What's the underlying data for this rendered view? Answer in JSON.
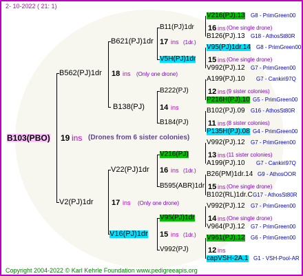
{
  "header": {
    "date": "2- 10-2022 ( 21:  1)"
  },
  "footer": {
    "copyright": "Copyright 2004-2022 © Karl Kehrle Foundation    www.pedigreeapis.org"
  },
  "root": {
    "name": "B103(PBO)",
    "gen": "19",
    "ins": "ins",
    "note": "(Drones from 6 sister colonies)"
  },
  "g1": {
    "top": {
      "name": "B562(PJ)1dr",
      "gen": "18",
      "ins": "ins",
      "note": "(Only one drone)"
    },
    "bottom": {
      "name": "V2(PJ)1dr",
      "gen": "17",
      "ins": "ins",
      "note": "(Only one drone)"
    }
  },
  "g2": {
    "n1": {
      "name": "B621(PJ)1dr",
      "gen": "17",
      "ins": "ins",
      "note": "(1dr.)"
    },
    "n2": {
      "name": "B138(PJ)",
      "gen": "14",
      "ins": "ins"
    },
    "n3": {
      "name": "V22(PJ)1dr",
      "gen": "16",
      "ins": "ins",
      "note": "(1dr.)"
    },
    "n4": {
      "name": "V16(PJ)1dr",
      "gen": "15",
      "ins": "ins",
      "note": "(1dr.)"
    }
  },
  "g3": {
    "n1": {
      "name": "B11(PJ)1dr",
      "gen": "16",
      "ins": "ins",
      "note": "(One single drone)"
    },
    "n2": {
      "name": "V5H(PJ)1dr",
      "gen": "15",
      "ins": "ins",
      "note": "(One single drone)"
    },
    "n3": {
      "name": "B222(PJ)",
      "gen": "12",
      "ins": "ins",
      "note": "(9 sister colonies)"
    },
    "n4": {
      "name": "B184(PJ)",
      "gen": "11",
      "ins": "ins",
      "note": "(8 sister colonies)"
    },
    "n5": {
      "name": "V216(PJ)",
      "gen": "13",
      "ins": "ins",
      "note": "(11 sister colonies)"
    },
    "n6": {
      "name": "B595(ABR)1dr",
      "gen": "15",
      "ins": "ins",
      "note": "(One single drone)"
    },
    "n7": {
      "name": "V95(PJ)1dr",
      "gen": "14",
      "ins": "ins",
      "note": "(One single drone)"
    },
    "n8": {
      "name": "V992(PJ)",
      "gen": "12",
      "ins": "ins"
    }
  },
  "g4": [
    {
      "name": "V216(PJ).13",
      "aff": "G8 - PrimGreen00"
    },
    {
      "name": "B126(PJ).13",
      "aff": "G18 - AthosSt80R"
    },
    {
      "name": "V95(PJ)1dr.14",
      "aff": "G8 - PrimGreen00"
    },
    {
      "name": "V992(PJ).12",
      "aff": "G7 - PrimGreen00"
    },
    {
      "name": "A199(PJ).10",
      "aff": "G7 - Cankiri97Q"
    },
    {
      "name": "P216H(PJ).10",
      "aff": "G5 - PrimGreen00"
    },
    {
      "name": "B102(PJ).09",
      "aff": "G16 - AthosSt80R"
    },
    {
      "name": "P135H(PJ).08",
      "aff": "G4 - PrimGreen00"
    },
    {
      "name": "V992(PJ).12",
      "aff": "G7 - PrimGreen00"
    },
    {
      "name": "A199(PJ).10",
      "aff": "G7 - Cankiri97Q"
    },
    {
      "name": "B26(PM)1dr.14",
      "aff": "G9 - AthosOOR"
    },
    {
      "name": "B102(RL)1dr.C",
      "aff": "G17 - AthosSt80R"
    },
    {
      "name": "V992(PJ).12",
      "aff": "G7 - PrimGreen00"
    },
    {
      "name": "V964(PJ).12",
      "aff": "G7 - PrimGreen00"
    },
    {
      "name": "V961(PJ).12",
      "aff": "G6 - PrimGreen00"
    },
    {
      "name": "capVSH-2A.1",
      "aff": "G1 - VSH-Pool-AR"
    }
  ],
  "colors": {
    "frame": "#c000c0",
    "green": "#00c000",
    "cyan": "#00e0ff",
    "rootbg": "#ffc0ff",
    "footer": "#008000"
  }
}
